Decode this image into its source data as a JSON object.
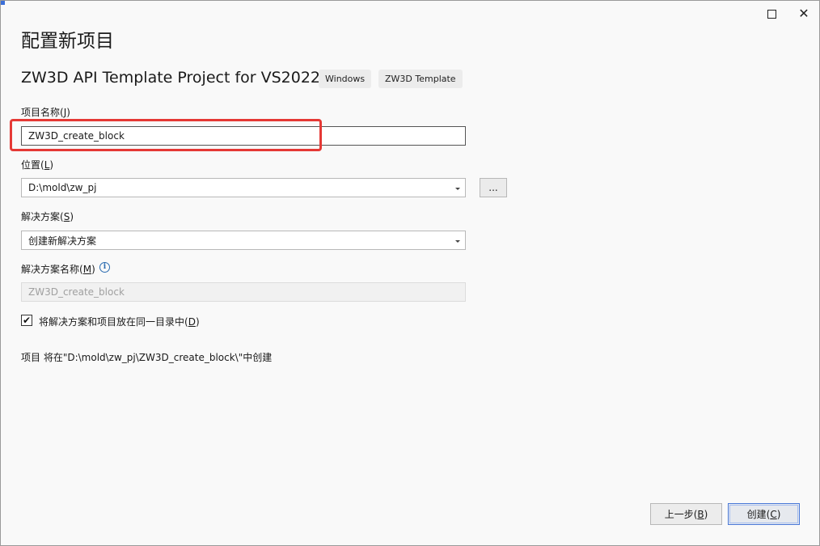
{
  "window": {
    "maximize_icon": "maximize-icon",
    "close_icon": "close-icon",
    "close_glyph": "✕"
  },
  "header": {
    "page_title": "配置新项目",
    "template_name": "ZW3D API Template Project for VS2022",
    "tags": [
      "Windows",
      "ZW3D Template"
    ]
  },
  "form": {
    "project_name": {
      "label": "项目名称",
      "accel": "J",
      "value": "ZW3D_create_block"
    },
    "location": {
      "label": "位置",
      "accel": "L",
      "value": "D:\\mold\\zw_pj",
      "browse_label": "..."
    },
    "solution": {
      "label": "解决方案",
      "accel": "S",
      "value": "创建新解决方案"
    },
    "solution_name": {
      "label": "解决方案名称",
      "accel": "M",
      "value": "ZW3D_create_block",
      "info_icon": "info-icon"
    },
    "same_dir": {
      "label": "将解决方案和项目放在同一目录中",
      "accel": "D",
      "checked": true,
      "check_glyph": "✔"
    }
  },
  "summary": "项目 将在\"D:\\mold\\zw_pj\\ZW3D_create_block\\\"中创建",
  "footer": {
    "back_label": "上一步",
    "back_accel": "B",
    "create_label": "创建",
    "create_accel": "C"
  },
  "colors": {
    "highlight": "#e53935",
    "accent": "#4a79d8"
  }
}
